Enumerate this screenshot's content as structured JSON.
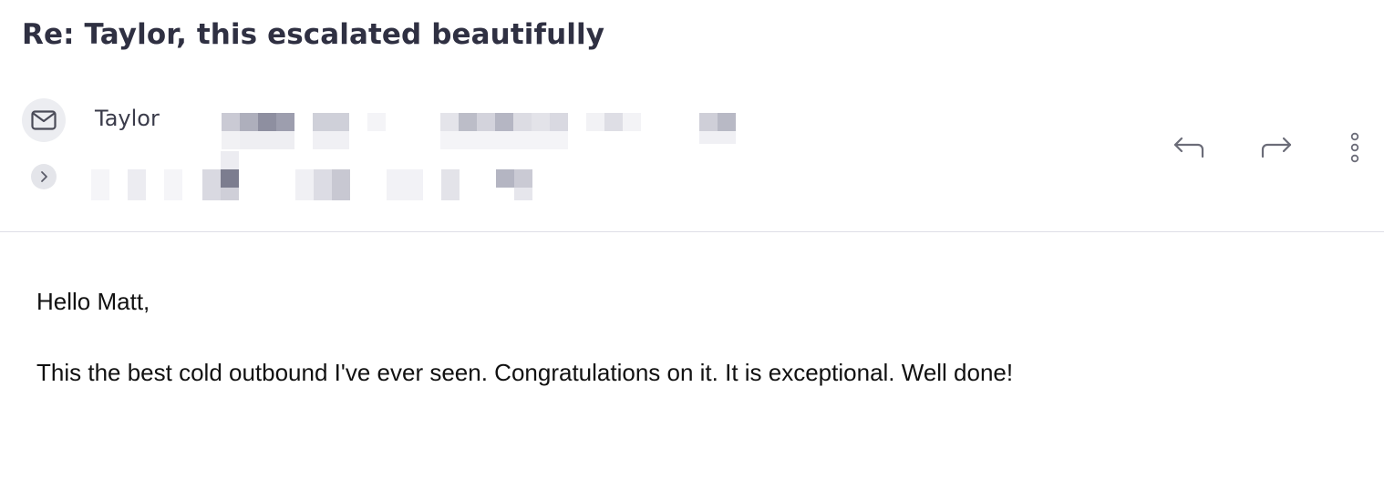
{
  "email": {
    "subject": "Re: Taylor, this escalated beautifully",
    "sender_name": "Taylor",
    "greeting": "Hello Matt,",
    "body_text": "This the best cold outbound I've ever seen. Congratulations on it. It is exceptional. Well done!"
  },
  "icons": {
    "avatar": "mail-envelope-icon",
    "expand": "chevron-right-icon",
    "reply": "reply-icon",
    "forward": "forward-icon",
    "more": "more-vertical-icon"
  },
  "colors": {
    "subject_text": "#2f3042",
    "icon_stroke": "#6b6c78",
    "divider": "#dedfe7",
    "body_text": "#111111"
  }
}
